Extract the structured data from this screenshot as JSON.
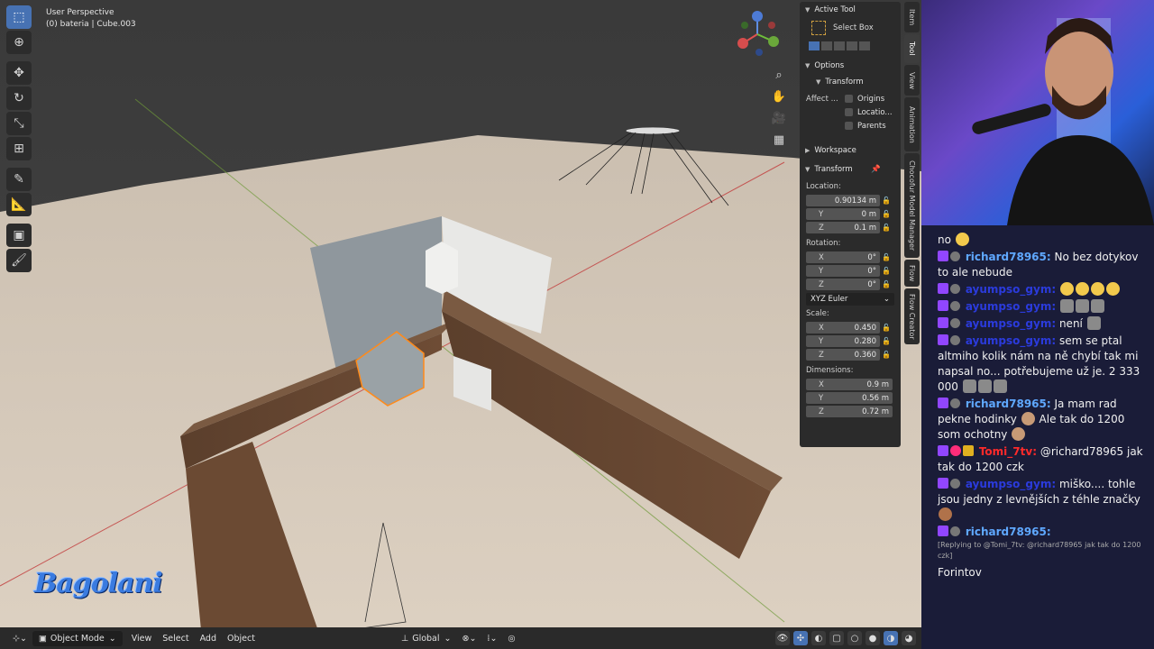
{
  "viewport": {
    "perspective": "User Perspective",
    "object_info": "(0) bateria | Cube.003",
    "logo_text": "Bagolani"
  },
  "toolbar": {
    "tools": [
      "select-box",
      "cursor",
      "move",
      "rotate",
      "scale",
      "transform",
      "annotate",
      "measure",
      "add-cube",
      "paint"
    ]
  },
  "nav": {
    "icons": [
      "zoom-icon",
      "pan-icon",
      "camera-icon",
      "grid-icon"
    ]
  },
  "npanel": {
    "active_tool_header": "Active Tool",
    "active_tool_name": "Select Box",
    "options_header": "Options",
    "transform_sub": "Transform",
    "affect_label": "Affect ...",
    "affect_options": [
      "Origins",
      "Locatio...",
      "Parents"
    ],
    "workspace_header": "Workspace",
    "transform_header": "Transform",
    "location_label": "Location:",
    "location": [
      {
        "axis": "",
        "value": "0.90134 m"
      },
      {
        "axis": "Y",
        "value": "0 m"
      },
      {
        "axis": "Z",
        "value": "0.1 m"
      }
    ],
    "rotation_label": "Rotation:",
    "rotation": [
      {
        "axis": "X",
        "value": "0°"
      },
      {
        "axis": "Y",
        "value": "0°"
      },
      {
        "axis": "Z",
        "value": "0°"
      }
    ],
    "rotation_mode": "XYZ Euler",
    "scale_label": "Scale:",
    "scale": [
      {
        "axis": "X",
        "value": "0.450"
      },
      {
        "axis": "Y",
        "value": "0.280"
      },
      {
        "axis": "Z",
        "value": "0.360"
      }
    ],
    "dimensions_label": "Dimensions:",
    "dimensions": [
      {
        "axis": "X",
        "value": "0.9 m"
      },
      {
        "axis": "Y",
        "value": "0.56 m"
      },
      {
        "axis": "Z",
        "value": "0.72 m"
      }
    ]
  },
  "vtabs": [
    "Item",
    "Tool",
    "View",
    "Animation",
    "Chocofur Model Manager",
    "Flow",
    "Flow Creator"
  ],
  "header": {
    "mode": "Object Mode",
    "menus": [
      "View",
      "Select",
      "Add",
      "Object"
    ],
    "orientation": "Global"
  },
  "chat": {
    "messages": [
      {
        "user": "",
        "text": "no",
        "emotes_after": [
          "y"
        ]
      },
      {
        "user": "richard78965:",
        "user_color": "#5fa8ff",
        "text": "No bez dotykov to ale nebude"
      },
      {
        "user": "ayumpso_gym:",
        "user_color": "#2b3bdc",
        "text": "",
        "emotes_after": [
          "y",
          "y",
          "y",
          "y"
        ]
      },
      {
        "user": "ayumpso_gym:",
        "user_color": "#2b3bdc",
        "text": "",
        "emotes_after": [
          "g",
          "g",
          "g"
        ]
      },
      {
        "user": "ayumpso_gym:",
        "user_color": "#2b3bdc",
        "text": "není",
        "emotes_after": [
          "g"
        ]
      },
      {
        "user": "ayumpso_gym:",
        "user_color": "#2b3bdc",
        "text": "sem se ptal altmiho kolik nám na ně chybí tak mi napsal no... potřebujeme už je. 2 333 000",
        "emotes_after": [
          "g",
          "g",
          "g"
        ]
      },
      {
        "user": "richard78965:",
        "user_color": "#5fa8ff",
        "text": "Ja mam rad pekne hodinky",
        "text2": "Ale tak do 1200 som ochotny",
        "emotes_mid": [
          "f"
        ],
        "emotes_after": [
          "f"
        ]
      },
      {
        "user": "Tomi_7tv:",
        "user_color": "#ff2a2a",
        "text": "@richard78965 jak tak do 1200 czk"
      },
      {
        "user": "ayumpso_gym:",
        "user_color": "#2b3bdc",
        "text": "miško.... tohle jsou jedny z levnějších z téhle značky",
        "emotes_after": [
          "m"
        ]
      },
      {
        "user": "richard78965:",
        "user_color": "#5fa8ff",
        "text": ""
      }
    ],
    "reply_note": "[Replying to @Tomi_7tv: @richard78965 jak tak do 1200 czk]",
    "last_text": "Forintov"
  }
}
